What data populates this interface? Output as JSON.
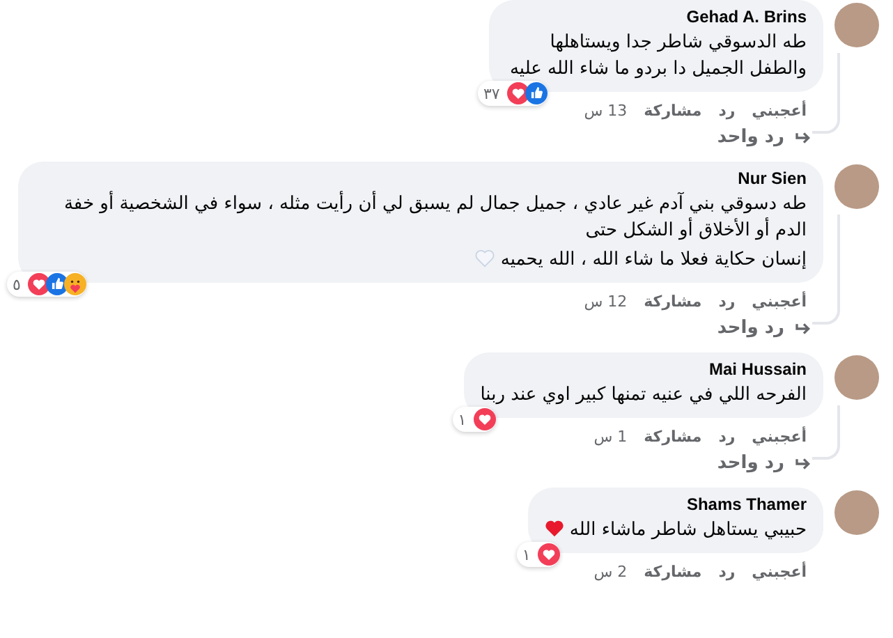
{
  "comments": [
    {
      "name": "Gehad A. Brins",
      "paragraphs": [
        "طه الدسوقي شاطر جدا ويستاهلها والطفل الجميل دا بردو ما شاء الله عليه"
      ],
      "reactions": [
        {
          "kind": "love"
        },
        {
          "kind": "like"
        }
      ],
      "reaction_count": "٣٧",
      "actions": [
        "أعجبني",
        "رد",
        "مشاركة"
      ],
      "time": "13 س",
      "replies": "رد واحد",
      "wide": false
    },
    {
      "name": "Nur Sien",
      "paragraphs": [
        "طه دسوقي بني آدم غير عادي ، جميل جمال لم يسبق لي أن رأيت مثله ، سواء في الشخصية أو خفة الدم أو الأخلاق أو الشكل حتى",
        "إنسان حكاية فعلا ما شاء الله ، الله يحميه"
      ],
      "end_emoji": {
        "kind": "white-heart"
      },
      "reactions": [
        {
          "kind": "love"
        },
        {
          "kind": "like"
        },
        {
          "kind": "care"
        }
      ],
      "reaction_count": "٥",
      "actions": [
        "أعجبني",
        "رد",
        "مشاركة"
      ],
      "time": "12 س",
      "replies": "رد واحد",
      "wide": true
    },
    {
      "name": "Mai Hussain",
      "paragraphs": [
        "الفرحه اللي في عنيه تمنها كبير اوي عند ربنا"
      ],
      "reactions": [
        {
          "kind": "love"
        }
      ],
      "reaction_count": "١",
      "actions": [
        "أعجبني",
        "رد",
        "مشاركة"
      ],
      "time": "1 س",
      "replies": "رد واحد",
      "wide": true
    },
    {
      "name": "Shams Thamer",
      "paragraphs": [
        "حبيبي يستاهل شاطر ماشاء الله"
      ],
      "end_emoji": {
        "kind": "red-heart"
      },
      "reactions": [
        {
          "kind": "love"
        }
      ],
      "reaction_count": "١",
      "actions": [
        "أعجبني",
        "رد",
        "مشاركة"
      ],
      "time": "2 س"
    }
  ]
}
